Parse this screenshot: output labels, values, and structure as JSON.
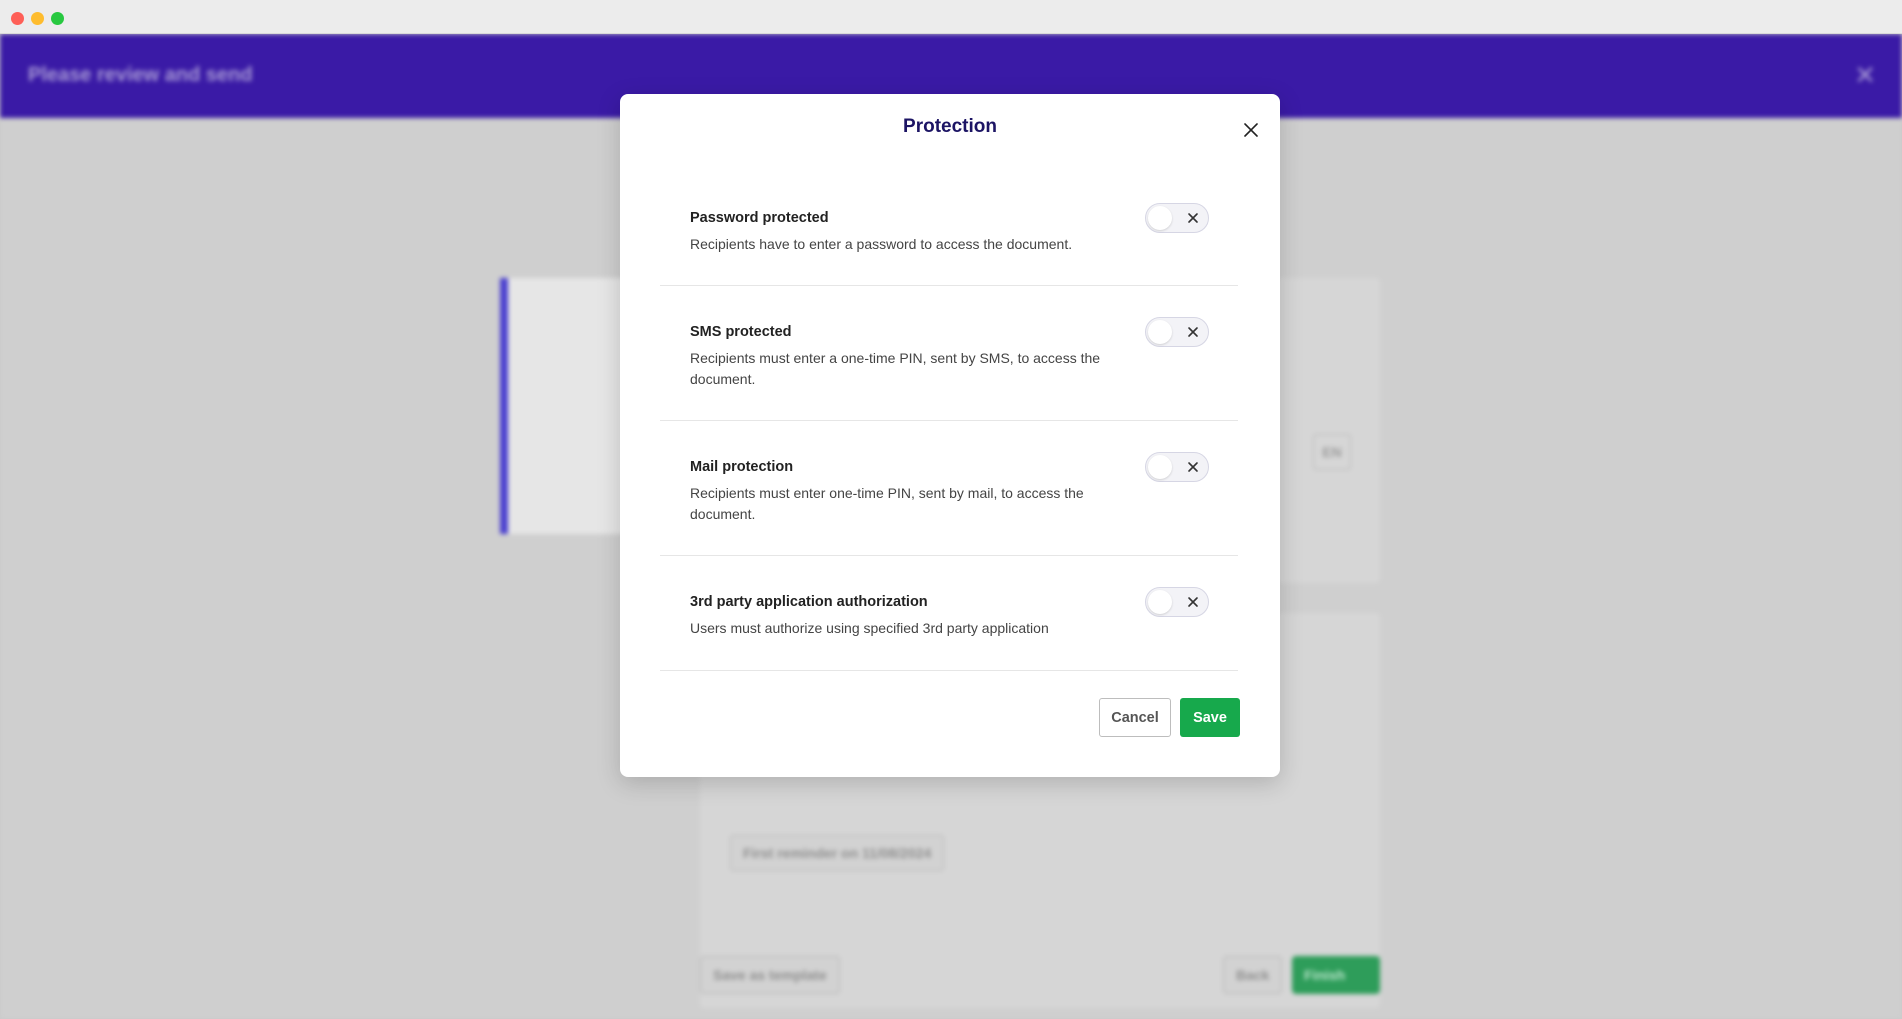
{
  "background": {
    "header_title": "Please review and send",
    "close_symbol": "✕",
    "language_badge": "EN",
    "reminder_chip": "First reminder on 11/08/2024",
    "save_template_label": "Save as template",
    "back_label": "Back",
    "finish_label": "Finish"
  },
  "modal": {
    "title": "Protection",
    "close_icon": "close-icon",
    "options": [
      {
        "title": "Password protected",
        "description": "Recipients have to enter a password to access the document.",
        "enabled": false
      },
      {
        "title": "SMS protected",
        "description": "Recipients must enter a one-time PIN, sent by SMS, to access the document.",
        "enabled": false
      },
      {
        "title": "Mail protection",
        "description": "Recipients must enter one-time PIN, sent by mail, to access the document.",
        "enabled": false
      },
      {
        "title": "3rd party application authorization",
        "description": "Users must authorize using specified 3rd party application",
        "enabled": false
      }
    ],
    "cancel_label": "Cancel",
    "save_label": "Save"
  },
  "colors": {
    "header_bg": "#3a1aa6",
    "modal_title": "#1c1464",
    "save_button": "#17a94c"
  }
}
